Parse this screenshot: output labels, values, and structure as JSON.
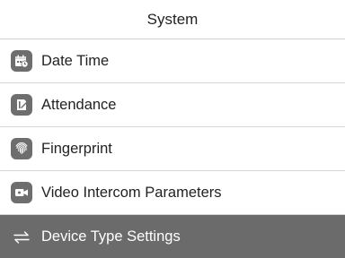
{
  "header": {
    "title": "System"
  },
  "menu": {
    "items": [
      {
        "label": "Date Time",
        "icon": "calendar-clock-icon"
      },
      {
        "label": "Attendance",
        "icon": "attendance-icon"
      },
      {
        "label": "Fingerprint",
        "icon": "fingerprint-icon"
      },
      {
        "label": "Video Intercom Parameters",
        "icon": "video-camera-icon"
      },
      {
        "label": "Device Type Settings",
        "icon": "switch-arrows-icon",
        "selected": true
      }
    ]
  },
  "colors": {
    "icon_bg": "#6e6e6e",
    "selected_bg": "#6b6b6b",
    "text": "#222222",
    "selected_text": "#ffffff",
    "divider": "#d6d6d6"
  }
}
